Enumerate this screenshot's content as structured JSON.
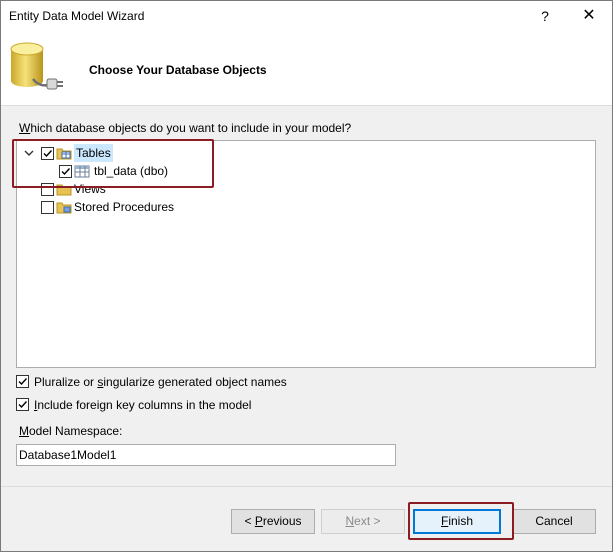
{
  "window": {
    "title": "Entity Data Model Wizard",
    "help_glyph": "?",
    "close_glyph": "✕"
  },
  "header": {
    "title": "Choose Your Database Objects",
    "icon": "database-connection-icon"
  },
  "prompt": {
    "mnemonic": "W",
    "rest": "hich database objects do you want to include in your model?"
  },
  "tree": {
    "items": [
      {
        "label": "Tables",
        "checked": true,
        "expanded": true,
        "icon": "tables-folder-icon",
        "selected": true
      },
      {
        "label": "tbl_data (dbo)",
        "checked": true,
        "icon": "table-icon"
      },
      {
        "label": "Views",
        "checked": false,
        "icon": "views-folder-icon"
      },
      {
        "label": "Stored Procedures",
        "checked": false,
        "icon": "stored-procedures-folder-icon"
      }
    ]
  },
  "options": {
    "pluralize": {
      "pre": "Pluralize or ",
      "mnemonic": "s",
      "post": "ingularize generated object names",
      "checked": true
    },
    "foreign_keys": {
      "pre": "",
      "mnemonic": "I",
      "post": "nclude foreign key columns in the model",
      "checked": true
    }
  },
  "namespace": {
    "label_mnemonic": "M",
    "label_rest": "odel Namespace:",
    "value": "Database1Model1"
  },
  "buttons": {
    "previous": {
      "pre": "< ",
      "mnemonic": "P",
      "post": "revious"
    },
    "next": {
      "mnemonic": "N",
      "post": "ext >"
    },
    "finish": {
      "mnemonic": "F",
      "post": "inish"
    },
    "cancel": "Cancel"
  },
  "colors": {
    "highlight_border": "#8b1c24",
    "selection": "#cce8ff",
    "default_button_border": "#0078d7"
  }
}
